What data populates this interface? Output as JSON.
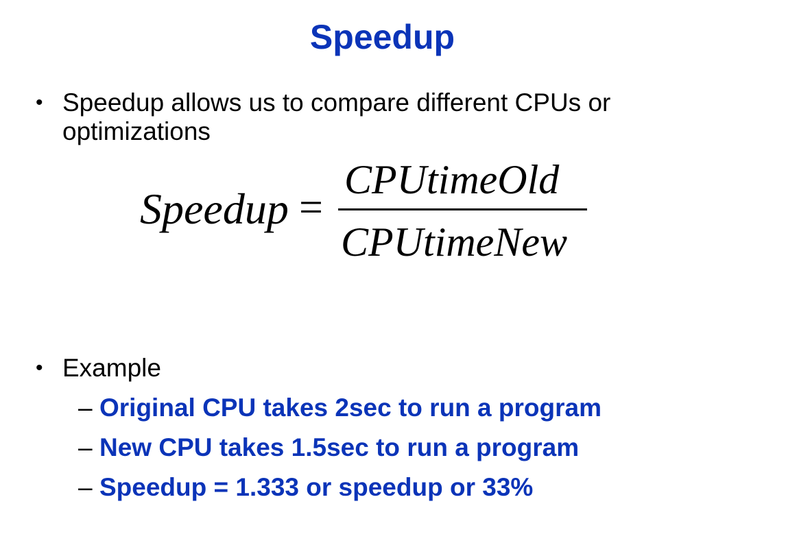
{
  "title": "Speedup",
  "bullets": [
    {
      "marker": "•",
      "lines": [
        "Speedup allows us to compare different CPUs or",
        "optimizations"
      ]
    },
    {
      "marker": "•",
      "lines": [
        "Example"
      ]
    }
  ],
  "formula": {
    "lhs": "Speedup",
    "equals": "=",
    "numerator": "CPUtimeOld",
    "denominator": "CPUtimeNew"
  },
  "example_items": [
    {
      "marker": "–",
      "text": "Original CPU takes 2sec to run a program"
    },
    {
      "marker": "–",
      "text": "New CPU takes 1.5sec to run a program"
    },
    {
      "marker": "–",
      "text": "Speedup = 1.333 or speedup or 33%"
    }
  ],
  "colors": {
    "title": "#0b34b8",
    "emphasis_text": "#0b34b8",
    "body_text": "#000000",
    "background": "#ffffff"
  }
}
